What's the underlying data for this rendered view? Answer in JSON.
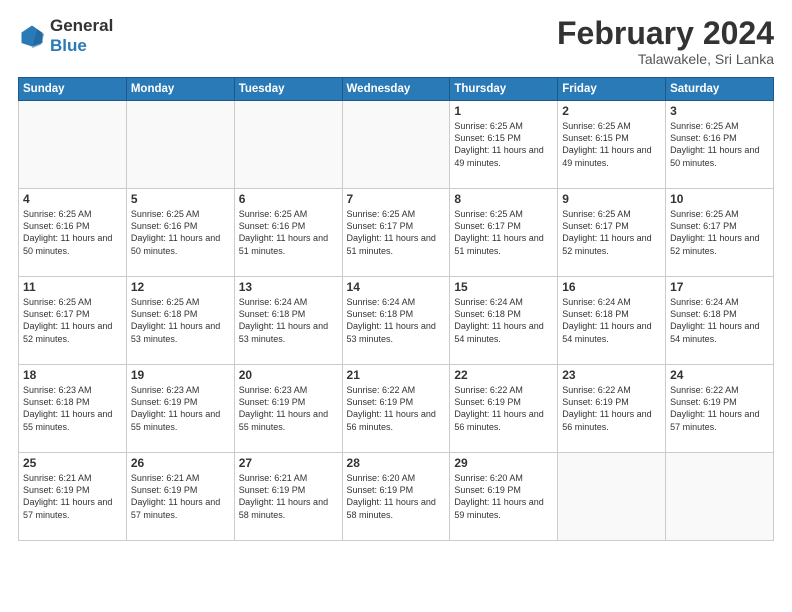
{
  "header": {
    "logo": {
      "general": "General",
      "blue": "Blue"
    },
    "title": "February 2024",
    "location": "Talawakele, Sri Lanka"
  },
  "days_of_week": [
    "Sunday",
    "Monday",
    "Tuesday",
    "Wednesday",
    "Thursday",
    "Friday",
    "Saturday"
  ],
  "weeks": [
    [
      {
        "day": "",
        "info": ""
      },
      {
        "day": "",
        "info": ""
      },
      {
        "day": "",
        "info": ""
      },
      {
        "day": "",
        "info": ""
      },
      {
        "day": "1",
        "info": "Sunrise: 6:25 AM\nSunset: 6:15 PM\nDaylight: 11 hours and 49 minutes."
      },
      {
        "day": "2",
        "info": "Sunrise: 6:25 AM\nSunset: 6:15 PM\nDaylight: 11 hours and 49 minutes."
      },
      {
        "day": "3",
        "info": "Sunrise: 6:25 AM\nSunset: 6:16 PM\nDaylight: 11 hours and 50 minutes."
      }
    ],
    [
      {
        "day": "4",
        "info": "Sunrise: 6:25 AM\nSunset: 6:16 PM\nDaylight: 11 hours and 50 minutes."
      },
      {
        "day": "5",
        "info": "Sunrise: 6:25 AM\nSunset: 6:16 PM\nDaylight: 11 hours and 50 minutes."
      },
      {
        "day": "6",
        "info": "Sunrise: 6:25 AM\nSunset: 6:16 PM\nDaylight: 11 hours and 51 minutes."
      },
      {
        "day": "7",
        "info": "Sunrise: 6:25 AM\nSunset: 6:17 PM\nDaylight: 11 hours and 51 minutes."
      },
      {
        "day": "8",
        "info": "Sunrise: 6:25 AM\nSunset: 6:17 PM\nDaylight: 11 hours and 51 minutes."
      },
      {
        "day": "9",
        "info": "Sunrise: 6:25 AM\nSunset: 6:17 PM\nDaylight: 11 hours and 52 minutes."
      },
      {
        "day": "10",
        "info": "Sunrise: 6:25 AM\nSunset: 6:17 PM\nDaylight: 11 hours and 52 minutes."
      }
    ],
    [
      {
        "day": "11",
        "info": "Sunrise: 6:25 AM\nSunset: 6:17 PM\nDaylight: 11 hours and 52 minutes."
      },
      {
        "day": "12",
        "info": "Sunrise: 6:25 AM\nSunset: 6:18 PM\nDaylight: 11 hours and 53 minutes."
      },
      {
        "day": "13",
        "info": "Sunrise: 6:24 AM\nSunset: 6:18 PM\nDaylight: 11 hours and 53 minutes."
      },
      {
        "day": "14",
        "info": "Sunrise: 6:24 AM\nSunset: 6:18 PM\nDaylight: 11 hours and 53 minutes."
      },
      {
        "day": "15",
        "info": "Sunrise: 6:24 AM\nSunset: 6:18 PM\nDaylight: 11 hours and 54 minutes."
      },
      {
        "day": "16",
        "info": "Sunrise: 6:24 AM\nSunset: 6:18 PM\nDaylight: 11 hours and 54 minutes."
      },
      {
        "day": "17",
        "info": "Sunrise: 6:24 AM\nSunset: 6:18 PM\nDaylight: 11 hours and 54 minutes."
      }
    ],
    [
      {
        "day": "18",
        "info": "Sunrise: 6:23 AM\nSunset: 6:18 PM\nDaylight: 11 hours and 55 minutes."
      },
      {
        "day": "19",
        "info": "Sunrise: 6:23 AM\nSunset: 6:19 PM\nDaylight: 11 hours and 55 minutes."
      },
      {
        "day": "20",
        "info": "Sunrise: 6:23 AM\nSunset: 6:19 PM\nDaylight: 11 hours and 55 minutes."
      },
      {
        "day": "21",
        "info": "Sunrise: 6:22 AM\nSunset: 6:19 PM\nDaylight: 11 hours and 56 minutes."
      },
      {
        "day": "22",
        "info": "Sunrise: 6:22 AM\nSunset: 6:19 PM\nDaylight: 11 hours and 56 minutes."
      },
      {
        "day": "23",
        "info": "Sunrise: 6:22 AM\nSunset: 6:19 PM\nDaylight: 11 hours and 56 minutes."
      },
      {
        "day": "24",
        "info": "Sunrise: 6:22 AM\nSunset: 6:19 PM\nDaylight: 11 hours and 57 minutes."
      }
    ],
    [
      {
        "day": "25",
        "info": "Sunrise: 6:21 AM\nSunset: 6:19 PM\nDaylight: 11 hours and 57 minutes."
      },
      {
        "day": "26",
        "info": "Sunrise: 6:21 AM\nSunset: 6:19 PM\nDaylight: 11 hours and 57 minutes."
      },
      {
        "day": "27",
        "info": "Sunrise: 6:21 AM\nSunset: 6:19 PM\nDaylight: 11 hours and 58 minutes."
      },
      {
        "day": "28",
        "info": "Sunrise: 6:20 AM\nSunset: 6:19 PM\nDaylight: 11 hours and 58 minutes."
      },
      {
        "day": "29",
        "info": "Sunrise: 6:20 AM\nSunset: 6:19 PM\nDaylight: 11 hours and 59 minutes."
      },
      {
        "day": "",
        "info": ""
      },
      {
        "day": "",
        "info": ""
      }
    ]
  ]
}
